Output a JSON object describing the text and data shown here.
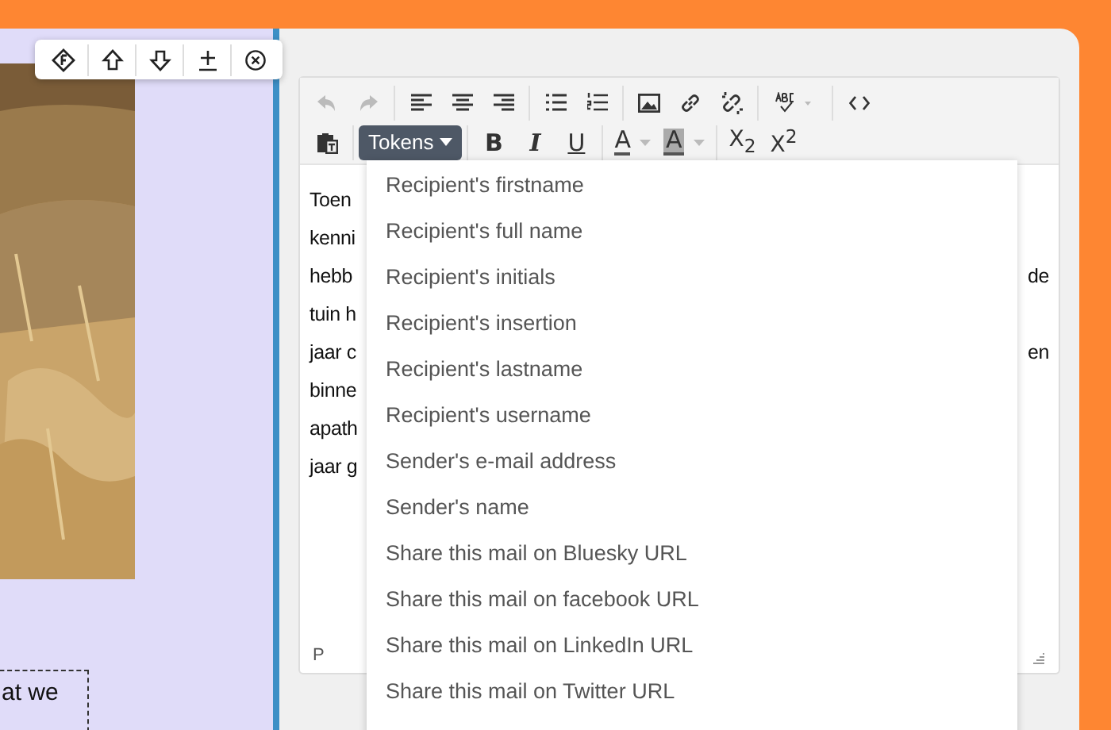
{
  "editor": {
    "format_buttons": [
      {
        "label": "B",
        "kind": "bold"
      },
      {
        "label": "I",
        "kind": "italic"
      },
      {
        "label": "U",
        "kind": "underline"
      },
      {
        "label": "A",
        "kind": "color"
      },
      {
        "label": "A",
        "kind": "highlight"
      },
      {
        "label": "X$_{2}$",
        "kind": "script"
      },
      {
        "label": "X$^{2}$",
        "kind": "script"
      }
    ],
    "tokens_button": {
      "label": "Tokens",
      "expanded": true
    },
    "content_lines": [
      {
        "left": "Toen"
      },
      {
        "left": "kenni"
      },
      {
        "left": "hebb",
        "right": "de"
      },
      {
        "left": "tuin h"
      },
      {
        "left": "jaar c",
        "right": "en"
      },
      {
        "left": "binne"
      },
      {
        "left": "apath"
      },
      {
        "left": "jaar g"
      }
    ],
    "status": "P"
  },
  "tokens_menu": [
    "Recipient's firstname",
    "Recipient's full name",
    "Recipient's initials",
    "Recipient's insertion",
    "Recipient's lastname",
    "Recipient's username",
    "Sender's e-mail address",
    "Sender's name",
    "Share this mail on Bluesky URL",
    "Share this mail on facebook URL",
    "Share this mail on LinkedIn URL",
    "Share this mail on Twitter URL"
  ],
  "side_note": [
    "at we"
  ]
}
